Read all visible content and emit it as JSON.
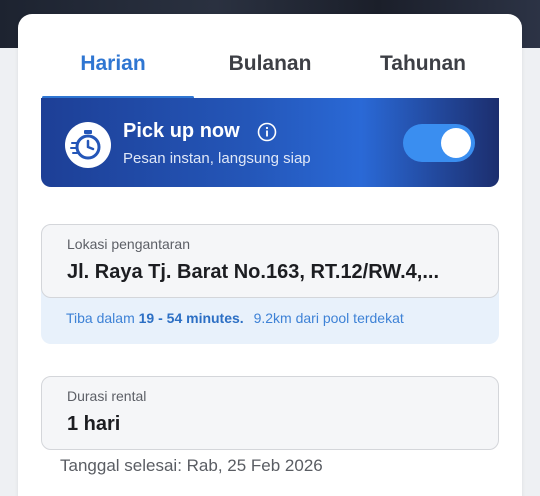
{
  "tabs": [
    {
      "label": "Harian",
      "active": true
    },
    {
      "label": "Bulanan",
      "active": false
    },
    {
      "label": "Tahunan",
      "active": false
    }
  ],
  "pickup": {
    "title": "Pick up now",
    "subtitle": "Pesan instan, langsung siap",
    "enabled": true
  },
  "location": {
    "label": "Lokasi pengantaran",
    "value": "Jl. Raya Tj. Barat No.163, RT.12/RW.4,...",
    "eta_prefix": "Tiba dalam",
    "eta_range": "19 - 54 minutes.",
    "distance": "9.2km dari pool terdekat"
  },
  "duration": {
    "label": "Durasi rental",
    "value": "1 hari",
    "end_date": "Tanggal selesai: Rab, 25 Feb 2026"
  },
  "colors": {
    "accent": "#2f76d2",
    "toggle_on": "#3a8ef0",
    "banner_dark": "#1d3f96"
  }
}
